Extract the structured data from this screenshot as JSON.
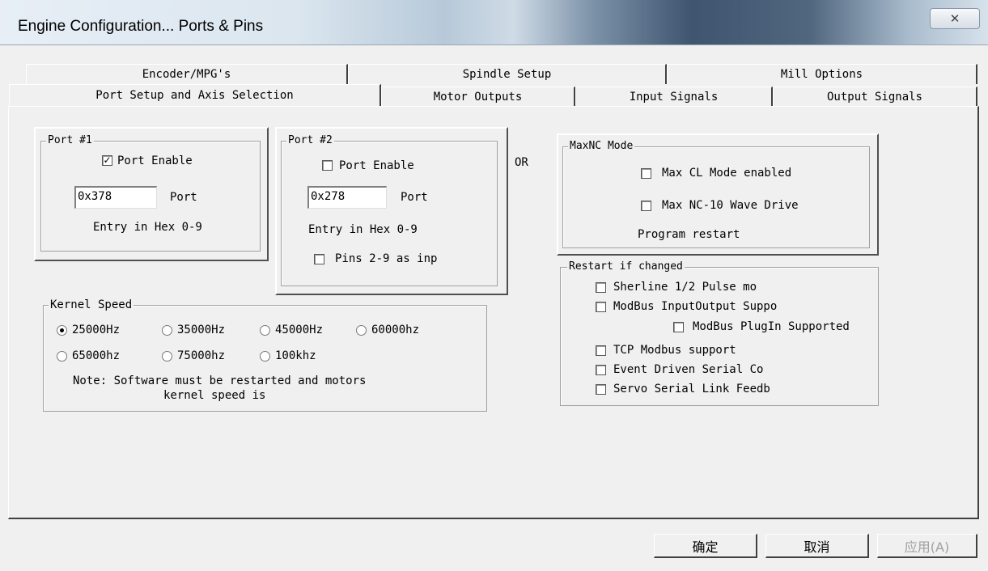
{
  "window": {
    "title": "Engine Configuration... Ports & Pins",
    "close_glyph": "✕"
  },
  "tabs_row1": [
    "Encoder/MPG's",
    "Spindle Setup",
    "Mill Options"
  ],
  "tabs_row2": [
    "Port Setup and Axis Selection",
    "Motor Outputs",
    "Input Signals",
    "Output Signals"
  ],
  "port1": {
    "title": "Port #1",
    "enable_label": "Port Enable",
    "enable_checked": true,
    "address": "0x378",
    "address_label": "Port",
    "hint": "Entry in Hex 0-9"
  },
  "port2": {
    "title": "Port #2",
    "enable_label": "Port Enable",
    "enable_checked": false,
    "address": "0x278",
    "address_label": "Port",
    "hint": "Entry in Hex 0-9",
    "pins_label": "Pins 2-9 as inp",
    "pins_checked": false
  },
  "or_label": "OR",
  "maxnc": {
    "title": "MaxNC Mode",
    "cl_mode": "Max CL Mode enabled",
    "wave_drive": "Max NC-10 Wave Drive",
    "restart_note": "Program restart"
  },
  "restart": {
    "title": "Restart if changed",
    "sherline": "Sherline 1/2 Pulse mo",
    "modbus_io": "ModBus InputOutput Suppo",
    "modbus_plugin": "ModBus PlugIn Supported",
    "tcp_modbus": "TCP Modbus support",
    "event_serial": "Event Driven Serial Co",
    "servo_serial": "Servo Serial Link Feedb"
  },
  "kernel": {
    "title": "Kernel Speed",
    "options": [
      "25000Hz",
      "35000Hz",
      "45000Hz",
      "60000hz",
      "65000hz",
      "75000hz",
      "100khz"
    ],
    "selected": "25000Hz",
    "note_line1": "Note: Software must be restarted and motors",
    "note_line2": "kernel speed is"
  },
  "buttons": {
    "ok": "确定",
    "cancel": "取消",
    "apply": "应用(A)"
  }
}
